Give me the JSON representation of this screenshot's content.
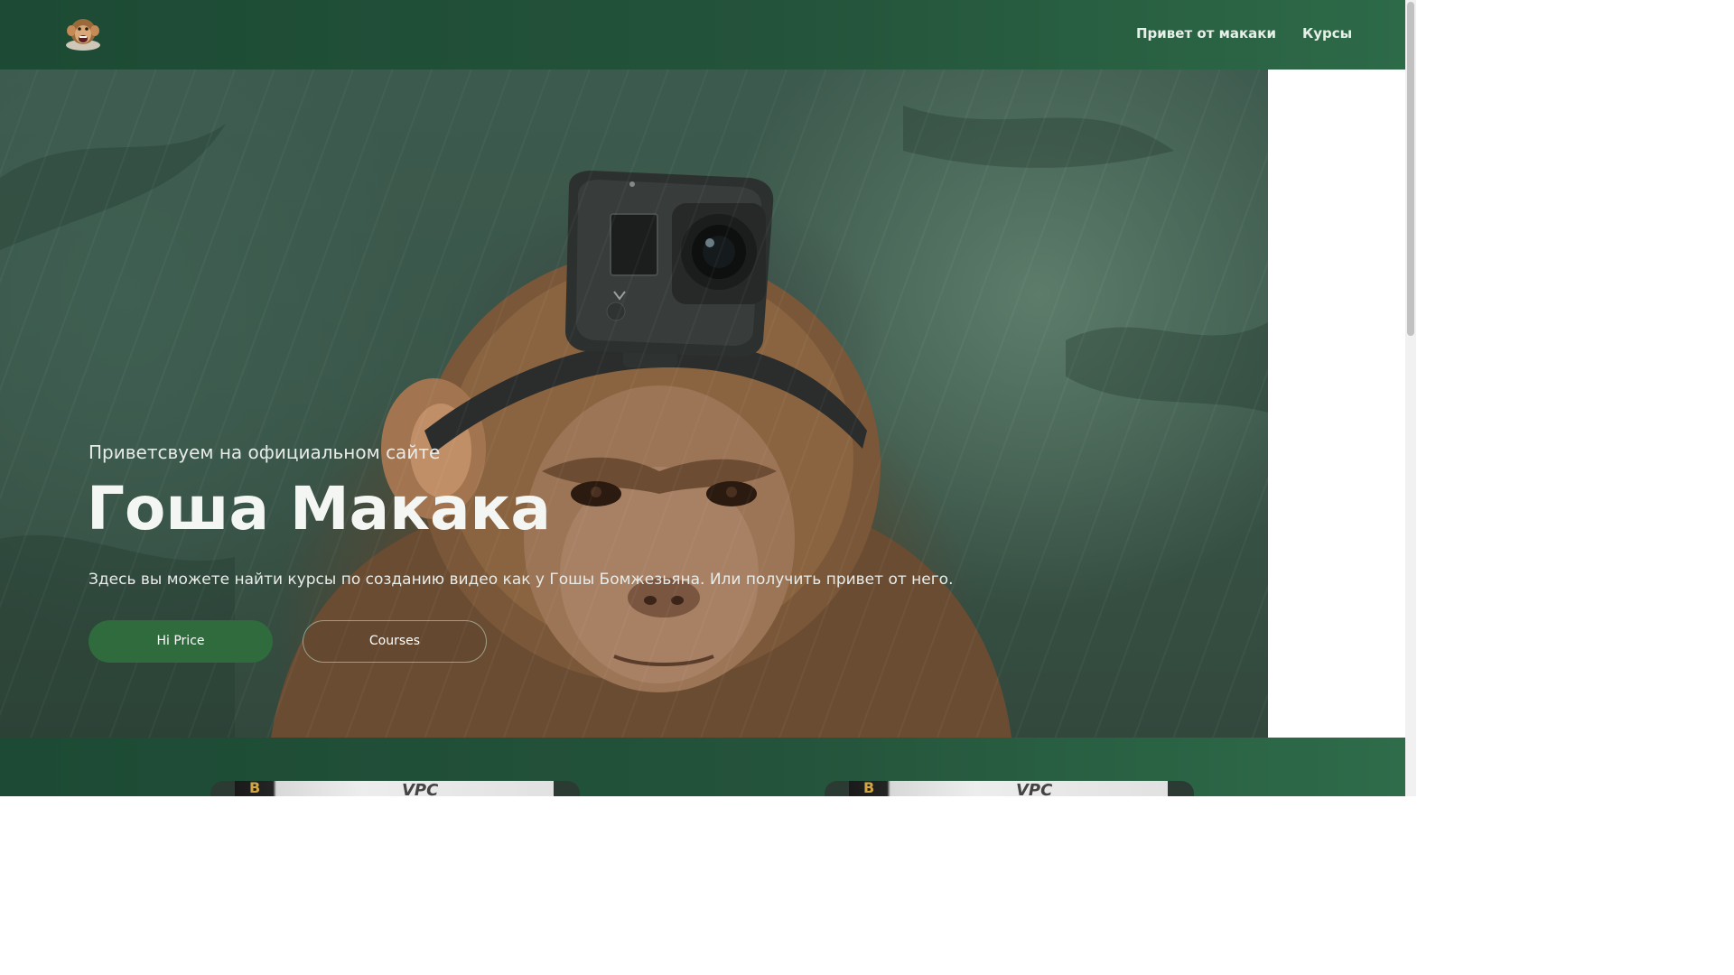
{
  "header": {
    "logo_icon": "monkey-logo-icon",
    "nav": [
      {
        "label": "Привет от макаки"
      },
      {
        "label": "Курсы"
      }
    ]
  },
  "hero": {
    "subtitle": "Приветсвуем на официальном сайте",
    "title": "Гоша Макака",
    "description": "Здесь вы можете найти курсы по созданию видео как у Гошы Бомжезьяна. Или получить привет от него.",
    "buttons": {
      "primary": "Hi Price",
      "secondary": "Courses"
    },
    "image_icon": "monkey-with-action-camera-image"
  },
  "courses": {
    "cards": [
      {
        "badge": "B",
        "logo": "VPC"
      },
      {
        "badge": "B",
        "logo": "VPC"
      }
    ]
  },
  "colors": {
    "header_bg": "#1c4a34",
    "primary_button": "#2f6b3c",
    "text_light": "#f4f6f4"
  }
}
